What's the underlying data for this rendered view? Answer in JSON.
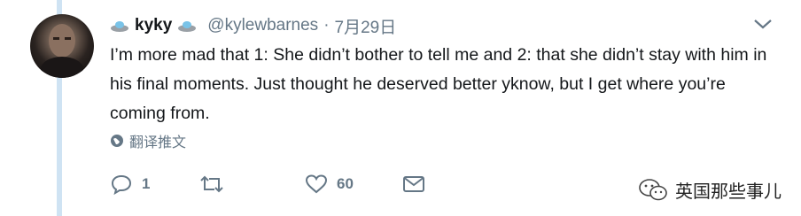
{
  "tweet": {
    "display_name": "kyky",
    "handle": "@kylewbarnes",
    "separator": "·",
    "date": "7月29日",
    "text": "I’m more mad that 1: She didn’t bother to tell me and 2: that she didn’t stay with him in his final moments. Just thought he deserved better yknow, but I get where you’re coming from.",
    "translate_label": "翻译推文"
  },
  "actions": {
    "reply_count": "1",
    "retweet_count": "",
    "like_count": "60"
  },
  "watermark": {
    "label": "英国那些事儿"
  },
  "colors": {
    "thread_line": "#cfe3f3",
    "secondary_text": "#657786",
    "primary_text": "#14171a"
  },
  "icons": [
    "flying-saucer-icon",
    "chevron-down-icon",
    "globe-icon",
    "reply-icon",
    "retweet-icon",
    "like-icon",
    "message-icon",
    "wechat-icon"
  ]
}
